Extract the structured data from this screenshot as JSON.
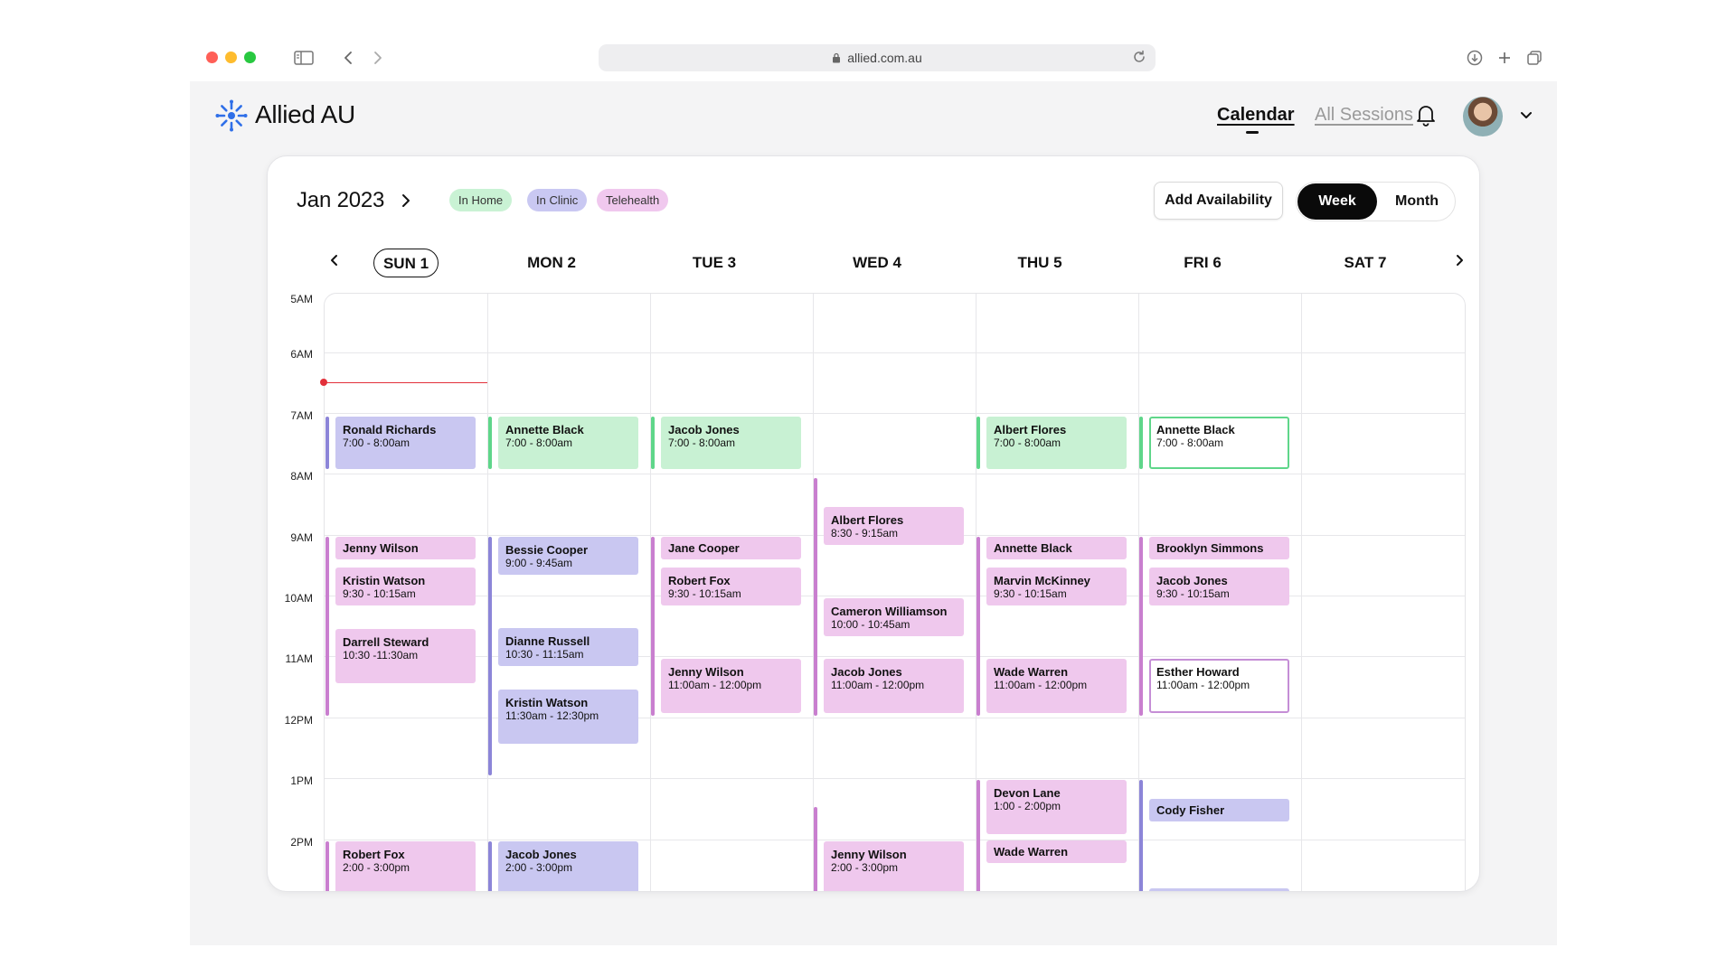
{
  "browser": {
    "url": "allied.com.au"
  },
  "header": {
    "brand": "Allied AU",
    "nav_calendar": "Calendar",
    "nav_all_sessions": "All Sessions"
  },
  "toolbar": {
    "month_label": "Jan 2023",
    "legend": [
      {
        "label": "In Home",
        "color": "#c9f2d4"
      },
      {
        "label": "In Clinic",
        "color": "#c9c8f2"
      },
      {
        "label": "Telehealth",
        "color": "#f0c8ee"
      }
    ],
    "add_availability": "Add Availability",
    "view_week": "Week",
    "view_month": "Month",
    "active_view": "Week"
  },
  "days": [
    "SUN 1",
    "MON 2",
    "TUE 3",
    "WED 4",
    "THU 5",
    "FRI 6",
    "SAT 7"
  ],
  "today_index": 0,
  "hours": [
    "5AM",
    "6AM",
    "7AM",
    "8AM",
    "9AM",
    "10AM",
    "11AM",
    "12PM",
    "1PM",
    "2PM"
  ],
  "colors": {
    "in_home": "#c8f1d3",
    "in_clinic": "#c9c7f1",
    "telehealth": "#efc8ed",
    "current_time": "#e2303a"
  },
  "events": {
    "sun": [
      {
        "name": "Ronald Richards",
        "time": "7:00 - 8:00am"
      },
      {
        "name": "Jenny Wilson",
        "time": ""
      },
      {
        "name": "Kristin Watson",
        "time": "9:30 - 10:15am"
      },
      {
        "name": "Darrell Steward",
        "time": "10:30 -11:30am"
      },
      {
        "name": "Robert Fox",
        "time": "2:00 - 3:00pm"
      }
    ],
    "mon": [
      {
        "name": "Annette Black",
        "time": "7:00 - 8:00am"
      },
      {
        "name": "Bessie Cooper",
        "time": "9:00 - 9:45am"
      },
      {
        "name": "Dianne Russell",
        "time": "10:30 - 11:15am"
      },
      {
        "name": "Kristin Watson",
        "time": "11:30am - 12:30pm"
      },
      {
        "name": "Jacob Jones",
        "time": "2:00 - 3:00pm"
      }
    ],
    "tue": [
      {
        "name": "Jacob Jones",
        "time": "7:00 - 8:00am"
      },
      {
        "name": "Jane Cooper",
        "time": ""
      },
      {
        "name": "Robert Fox",
        "time": "9:30 - 10:15am"
      },
      {
        "name": "Jenny Wilson",
        "time": "11:00am - 12:00pm"
      }
    ],
    "wed": [
      {
        "name": "Albert Flores",
        "time": "8:30 - 9:15am"
      },
      {
        "name": "Cameron Williamson",
        "time": "10:00 - 10:45am"
      },
      {
        "name": "Jacob Jones",
        "time": "11:00am - 12:00pm"
      },
      {
        "name": "Jenny Wilson",
        "time": "2:00 - 3:00pm"
      }
    ],
    "thu": [
      {
        "name": "Albert Flores",
        "time": "7:00 - 8:00am"
      },
      {
        "name": "Annette Black",
        "time": ""
      },
      {
        "name": "Marvin McKinney",
        "time": "9:30 - 10:15am"
      },
      {
        "name": "Wade Warren",
        "time": "11:00am - 12:00pm"
      },
      {
        "name": "Devon Lane",
        "time": "1:00 - 2:00pm"
      },
      {
        "name": "Wade Warren",
        "time": ""
      }
    ],
    "fri": [
      {
        "name": "Annette Black",
        "time": "7:00 - 8:00am"
      },
      {
        "name": "Brooklyn Simmons",
        "time": ""
      },
      {
        "name": "Jacob Jones",
        "time": "9:30 - 10:15am"
      },
      {
        "name": "Esther Howard",
        "time": "11:00am - 12:00pm"
      },
      {
        "name": "Cody Fisher",
        "time": ""
      }
    ]
  }
}
